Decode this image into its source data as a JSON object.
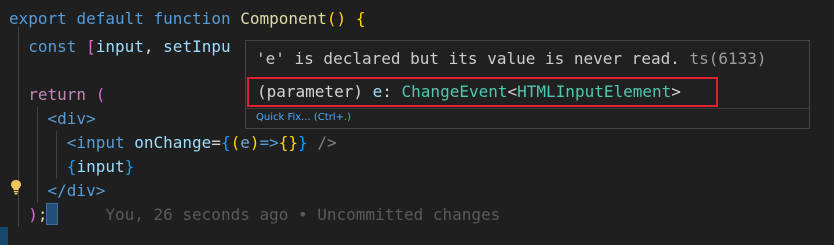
{
  "code": {
    "line1": {
      "kw_export": "export",
      "kw_default": "default",
      "kw_function": "function",
      "fn_name": "Component",
      "parens": "()",
      "brace": "{"
    },
    "line2": {
      "kw_const": "const",
      "bracket_open": "[",
      "var_input": "input",
      "comma": ",",
      "var_setInput_partial": "setInpu"
    },
    "line3": {
      "kw_return": "return",
      "paren": "("
    },
    "line4": {
      "tag_open": "<div>"
    },
    "line5": {
      "tag_input": "<input",
      "attr": "onChange",
      "eq": "=",
      "brace_open": "{",
      "paren_open": "(",
      "param": "e",
      "paren_close": ")",
      "arrow": "=>",
      "body": "{}",
      "brace_close": "}",
      "self_close": "/>"
    },
    "line6": {
      "brace_open": "{",
      "var": "input",
      "brace_close": "}"
    },
    "line7": {
      "tag_close": "</div>"
    },
    "line8": {
      "paren_close": ")",
      "semicolon": ";",
      "blame": "You, 26 seconds ago • Uncommitted changes"
    }
  },
  "hover": {
    "message": "'e' is declared but its value is never read.",
    "code_ref": "ts(6133)",
    "signature_prefix": "(parameter)",
    "signature_param": "e",
    "signature_colon": ":",
    "signature_type": "ChangeEvent",
    "signature_lt": "<",
    "signature_generic": "HTMLInputElement",
    "signature_gt": ">",
    "quick_fix": "Quick Fix... (Ctrl+.)"
  },
  "icons": {
    "lightbulb": "lightbulb-icon"
  },
  "colors": {
    "editor_bg": "#1f1f1f",
    "keyword": "#569cd6",
    "control": "#c586c0",
    "function": "#dcdcaa",
    "variable": "#9cdcfe",
    "highlight_box": "#e0202a",
    "lightbulb": "#f2c55c"
  }
}
